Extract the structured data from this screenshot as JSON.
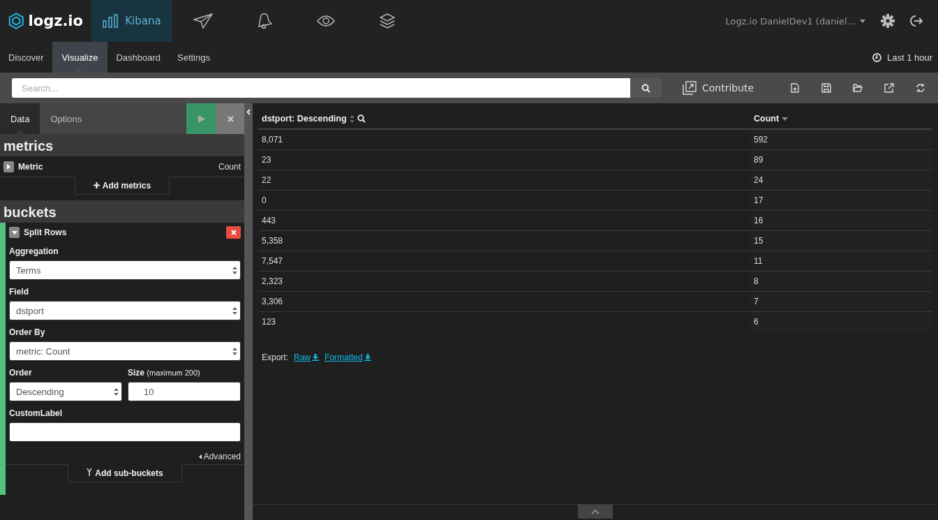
{
  "top_nav": {
    "logo": "logz.io",
    "apps": [
      {
        "kind": "bars",
        "label": "Kibana",
        "selected": true
      },
      {
        "kind": "plane",
        "selected": false
      },
      {
        "kind": "bell",
        "selected": false
      },
      {
        "kind": "eye",
        "selected": false
      },
      {
        "kind": "layers",
        "selected": false
      }
    ],
    "account": "Logz.io DanielDev1 (daniel..."
  },
  "nav_tabs": [
    {
      "label": "Discover",
      "selected": false
    },
    {
      "label": "Visualize",
      "selected": true
    },
    {
      "label": "Dashboard",
      "selected": false
    },
    {
      "label": "Settings",
      "selected": false
    }
  ],
  "time_range": "Last 1 hour",
  "toolbar": {
    "search": {
      "placeholder": "Search..."
    },
    "contribute": "Contribute",
    "actions": [
      {
        "kind": "new"
      },
      {
        "kind": "save"
      },
      {
        "kind": "open"
      },
      {
        "kind": "share"
      },
      {
        "kind": "refresh"
      }
    ]
  },
  "sidebar": {
    "tabs": [
      {
        "label": "Data",
        "selected": true
      },
      {
        "label": "Options",
        "selected": false
      }
    ],
    "metrics": {
      "title": "metrics",
      "items": [
        {
          "label": "Metric",
          "value": "Count",
          "expanded": false
        }
      ],
      "add": "Add metrics"
    },
    "buckets": {
      "title": "buckets",
      "items": [
        {
          "label": "Split Rows",
          "expanded": true,
          "aggregation": {
            "label": "Aggregation",
            "value": "Terms"
          },
          "field": {
            "label": "Field",
            "value": "dstport"
          },
          "order_by": {
            "label": "Order By",
            "value": "metric: Count"
          },
          "order": {
            "label": "Order",
            "value": "Descending"
          },
          "size": {
            "label": "Size",
            "hint": "(maximum 200)",
            "value": "10"
          },
          "custom_label": {
            "label": "CustomLabel"
          },
          "advanced": "Advanced"
        }
      ],
      "add": "Add sub-buckets"
    }
  },
  "table": {
    "columns": [
      {
        "label": "dstport: Descending",
        "kind": "sortable"
      },
      {
        "label": "Count",
        "kind": "sorted_desc"
      }
    ],
    "rows": [
      [
        "8,071",
        "592"
      ],
      [
        "23",
        "89"
      ],
      [
        "22",
        "24"
      ],
      [
        "0",
        "17"
      ],
      [
        "443",
        "16"
      ],
      [
        "5,358",
        "15"
      ],
      [
        "7,547",
        "11"
      ],
      [
        "2,323",
        "8"
      ],
      [
        "3,306",
        "7"
      ],
      [
        "123",
        "6"
      ]
    ],
    "export": {
      "label": "Export:",
      "links": [
        "Raw",
        "Formatted"
      ]
    }
  }
}
